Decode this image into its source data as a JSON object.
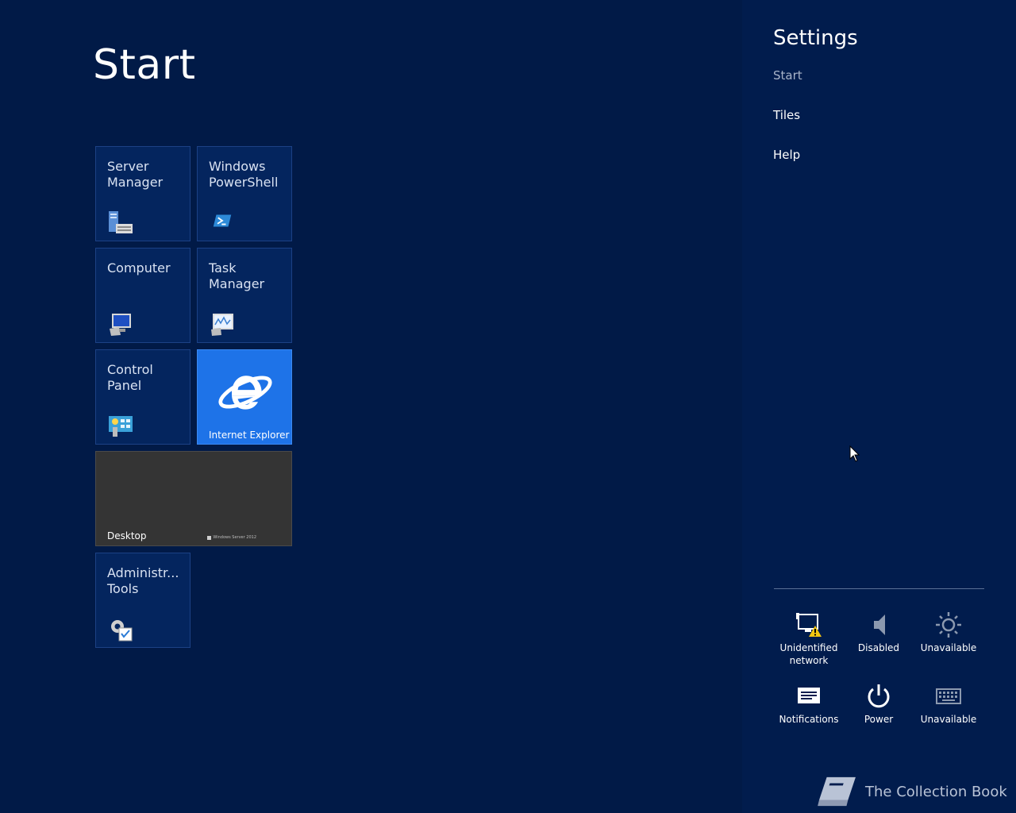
{
  "start": {
    "title": "Start"
  },
  "tiles": {
    "server_manager": "Server Manager",
    "powershell": "Windows PowerShell",
    "computer": "Computer",
    "task_manager": "Task Manager",
    "control_panel": "Control Panel",
    "internet_explorer": "Internet Explorer",
    "desktop": "Desktop",
    "desktop_brand": "Windows Server 2012",
    "admin_tools": "Administr... Tools"
  },
  "settings": {
    "title": "Settings",
    "items": [
      "Start",
      "Tiles",
      "Help"
    ]
  },
  "quick_settings": {
    "network": "Unidentified network",
    "volume": "Disabled",
    "brightness": "Unavailable",
    "notifications": "Notifications",
    "power": "Power",
    "keyboard": "Unavailable"
  },
  "watermark": {
    "text": "The Collection Book"
  },
  "icons": {
    "server_manager": "server-manager-icon",
    "powershell": "powershell-icon",
    "computer": "computer-icon",
    "task_manager": "task-manager-icon",
    "control_panel": "control-panel-icon",
    "internet_explorer": "internet-explorer-icon",
    "admin_tools": "admin-tools-icon",
    "network": "network-warning-icon",
    "volume": "speaker-icon",
    "brightness": "brightness-icon",
    "notifications": "notifications-icon",
    "power": "power-icon",
    "keyboard": "keyboard-icon"
  },
  "colors": {
    "background": "#011a47",
    "tile": "#04255e",
    "ie_tile": "#1e73e8",
    "desktop_tile": "#343434",
    "charm": "#011c4d"
  }
}
